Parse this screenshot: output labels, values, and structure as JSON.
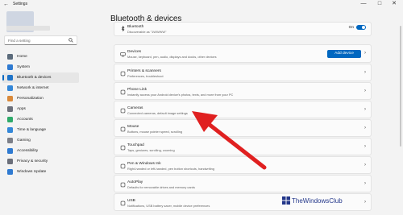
{
  "window": {
    "title": "Settings",
    "back_glyph": "←",
    "minimize_glyph": "—",
    "maximize_glyph": "□",
    "close_glyph": "✕"
  },
  "search": {
    "placeholder": "Find a setting"
  },
  "sidebar": {
    "items": [
      {
        "label": "Home",
        "icon": "home-icon",
        "color": "#5b6b7b"
      },
      {
        "label": "System",
        "icon": "system-icon",
        "color": "#2f7ad1"
      },
      {
        "label": "Bluetooth & devices",
        "icon": "bluetooth-icon",
        "color": "#1e73c8",
        "selected": true
      },
      {
        "label": "Network & internet",
        "icon": "network-icon",
        "color": "#3487d8"
      },
      {
        "label": "Personalization",
        "icon": "brush-icon",
        "color": "#d9893a"
      },
      {
        "label": "Apps",
        "icon": "apps-icon",
        "color": "#6b6f7a"
      },
      {
        "label": "Accounts",
        "icon": "accounts-icon",
        "color": "#2eaa6a"
      },
      {
        "label": "Time & language",
        "icon": "time-icon",
        "color": "#3487d8"
      },
      {
        "label": "Gaming",
        "icon": "gaming-icon",
        "color": "#7c7f88"
      },
      {
        "label": "Accessibility",
        "icon": "accessibility-icon",
        "color": "#2f7ad1"
      },
      {
        "label": "Privacy & security",
        "icon": "shield-icon",
        "color": "#6b6f7a"
      },
      {
        "label": "Windows Update",
        "icon": "update-icon",
        "color": "#2f7ad1"
      }
    ]
  },
  "main": {
    "title": "Bluetooth & devices",
    "bluetooth": {
      "title": "Bluetooth",
      "subtitle": "Discoverable as \"1WWWW\"",
      "toggle_label": "On",
      "toggle_on": true
    },
    "devices": {
      "title": "Devices",
      "subtitle": "Mouse, keyboard, pen, audio, displays and docks, other devices",
      "button": "Add device"
    },
    "rows": [
      {
        "title": "Printers & scanners",
        "subtitle": "Preferences, troubleshoot",
        "icon": "printer-icon"
      },
      {
        "title": "Phone Link",
        "subtitle": "Instantly access your Android device's photos, texts, and more from your PC",
        "icon": "phone-icon"
      },
      {
        "title": "Cameras",
        "subtitle": "Connected cameras, default image settings",
        "icon": "camera-icon"
      },
      {
        "title": "Mouse",
        "subtitle": "Buttons, mouse pointer speed, scrolling",
        "icon": "mouse-icon"
      },
      {
        "title": "Touchpad",
        "subtitle": "Taps, gestures, scrolling, zooming",
        "icon": "touchpad-icon"
      },
      {
        "title": "Pen & Windows Ink",
        "subtitle": "Right-handed or left-handed, pen button shortcuts, handwriting",
        "icon": "pen-icon"
      },
      {
        "title": "AutoPlay",
        "subtitle": "Defaults for removable drives and memory cards",
        "icon": "autoplay-icon"
      },
      {
        "title": "USB",
        "subtitle": "Notifications, USB battery saver, mobile device preferences",
        "icon": "usb-icon"
      }
    ],
    "chevron": "›"
  },
  "watermark": {
    "text": "TheWindowsClub"
  },
  "colors": {
    "accent": "#0067c0",
    "arrow": "#e02020"
  }
}
